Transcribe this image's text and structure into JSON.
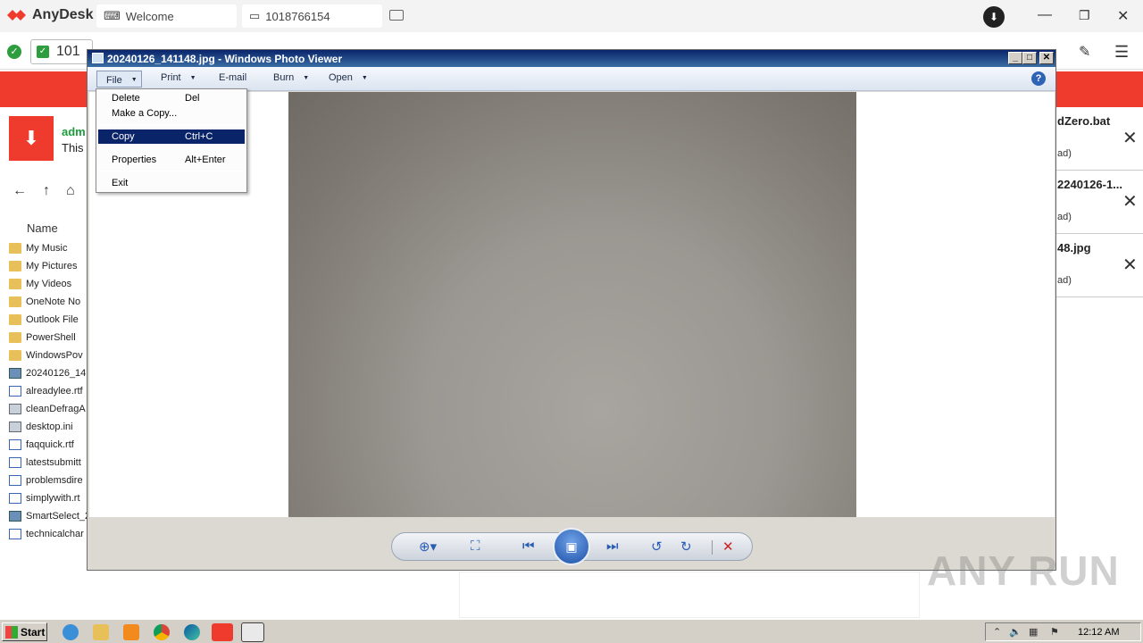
{
  "anydesk": {
    "app_name": "AnyDesk",
    "tabs": [
      {
        "label": "Welcome"
      },
      {
        "label": "1018766154"
      }
    ],
    "address_value": "101"
  },
  "remote": {
    "user_name": "adm",
    "user_sub": "This",
    "file_header": "Name",
    "files": [
      {
        "name": "My Music",
        "icon": "folder"
      },
      {
        "name": "My Pictures",
        "icon": "folder"
      },
      {
        "name": "My Videos",
        "icon": "folder"
      },
      {
        "name": "OneNote No",
        "icon": "folder"
      },
      {
        "name": "Outlook File",
        "icon": "folder"
      },
      {
        "name": "PowerShell",
        "icon": "folder"
      },
      {
        "name": "WindowsPov",
        "icon": "folder"
      },
      {
        "name": "20240126_14",
        "icon": "img"
      },
      {
        "name": "alreadylee.rtf",
        "icon": "doc"
      },
      {
        "name": "cleanDefragA",
        "icon": "gear"
      },
      {
        "name": "desktop.ini",
        "icon": "gear"
      },
      {
        "name": "faqquick.rtf",
        "icon": "doc"
      },
      {
        "name": "latestsubmitt",
        "icon": "doc"
      },
      {
        "name": "problemsdire",
        "icon": "doc"
      },
      {
        "name": "simplywith.rt",
        "icon": "doc"
      },
      {
        "name": "SmartSelect_2",
        "icon": "img"
      },
      {
        "name": "technicalchar",
        "icon": "doc"
      }
    ],
    "downloads": [
      {
        "title": "dZero.bat",
        "status": "ad)"
      },
      {
        "title": "2240126-1...",
        "status": "ad)"
      },
      {
        "title": "48.jpg",
        "status": "ad)"
      }
    ]
  },
  "photo_viewer": {
    "title": "20240126_141148.jpg - Windows Photo Viewer",
    "menus": [
      {
        "label": "File"
      },
      {
        "label": "Print"
      },
      {
        "label": "E-mail"
      },
      {
        "label": "Burn"
      },
      {
        "label": "Open"
      }
    ],
    "file_menu": [
      {
        "label": "Delete",
        "key": "Del"
      },
      {
        "label": "Make a Copy...",
        "key": ""
      },
      {
        "label": "Copy",
        "key": "Ctrl+C"
      },
      {
        "label": "Properties",
        "key": "Alt+Enter"
      },
      {
        "label": "Exit",
        "key": ""
      }
    ]
  },
  "taskbar": {
    "start_label": "Start",
    "time": "12:12 AM"
  },
  "watermark": "ANY RUN",
  "colors": {
    "anydesk_red": "#ef3b2d",
    "title_bar": "#0a246a",
    "menu_highlight": "#0a246a",
    "success_green": "#2e9d3e"
  }
}
